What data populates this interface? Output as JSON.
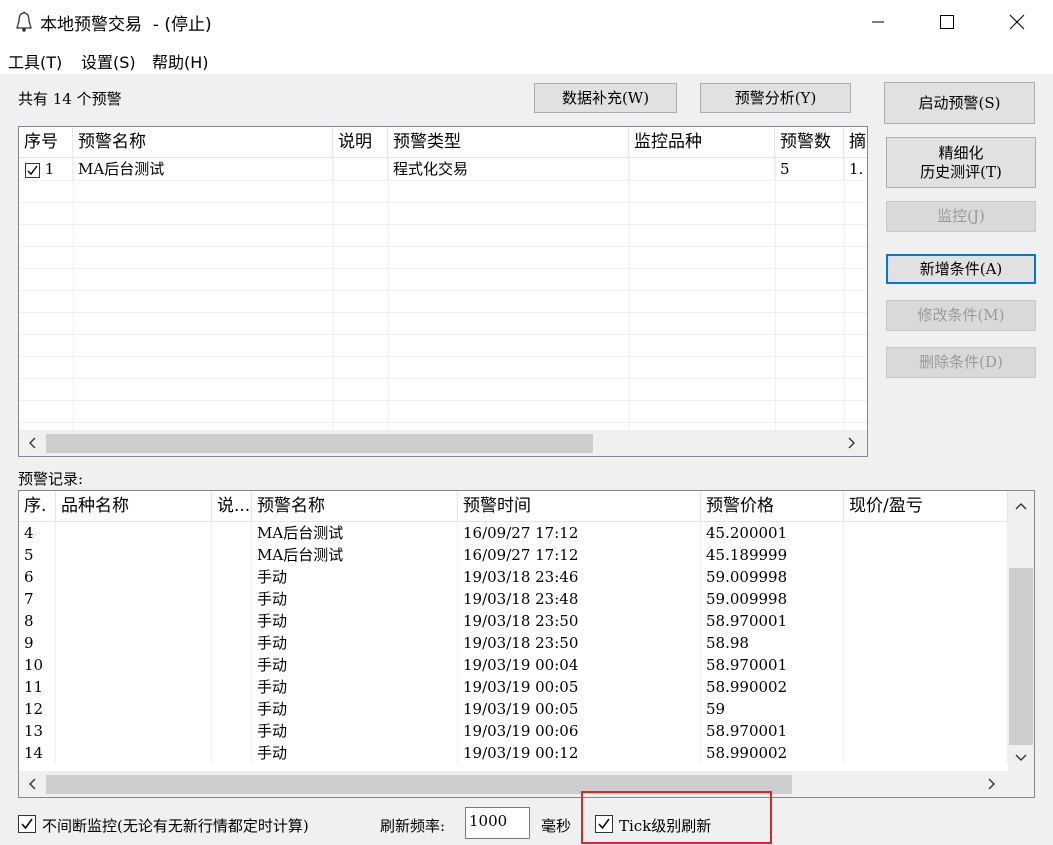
{
  "window": {
    "title": "本地预警交易  - (停止)",
    "minimize_icon": "minimize-icon",
    "maximize_icon": "maximize-icon",
    "close_icon": "close-icon"
  },
  "menu": [
    "工具(T)",
    "设置(S)",
    "帮助(H)"
  ],
  "alerts_summary": "共有 14 个预警",
  "buttons": {
    "data_supplement": "数据补充(W)",
    "alert_analysis": "预警分析(Y)",
    "start_alert": "启动预警(S)",
    "refine_line1": "精细化",
    "refine_line2": "历史测评(T)",
    "monitor": "监控(J)",
    "add_condition": "新增条件(A)",
    "edit_condition": "修改条件(M)",
    "delete_condition": "删除条件(D)"
  },
  "alerts_table": {
    "headers": [
      "序号",
      "预警名称",
      "说明",
      "预警类型",
      "监控品种",
      "预警数",
      "摘"
    ],
    "rows": [
      {
        "checked": true,
        "no": "1",
        "name": "MA后台测试",
        "desc": "",
        "type": "程式化交易",
        "symbol": "",
        "count": "5",
        "extra": "1."
      }
    ]
  },
  "records_label": "预警记录:",
  "records_table": {
    "headers": [
      "序.",
      "品种名称",
      "说...",
      "预警名称",
      "预警时间",
      "预警价格",
      "现价/盈亏"
    ],
    "rows": [
      {
        "no": "4",
        "symbol": "",
        "desc": "",
        "name": "MA后台测试",
        "time": "16/09/27 17:12",
        "price": "45.200001",
        "pnl": ""
      },
      {
        "no": "5",
        "symbol": "",
        "desc": "",
        "name": "MA后台测试",
        "time": "16/09/27 17:12",
        "price": "45.189999",
        "pnl": ""
      },
      {
        "no": "6",
        "symbol": "",
        "desc": "",
        "name": "手动",
        "time": "19/03/18 23:46",
        "price": "59.009998",
        "pnl": ""
      },
      {
        "no": "7",
        "symbol": "",
        "desc": "",
        "name": "手动",
        "time": "19/03/18 23:48",
        "price": "59.009998",
        "pnl": ""
      },
      {
        "no": "8",
        "symbol": "",
        "desc": "",
        "name": "手动",
        "time": "19/03/18 23:50",
        "price": "58.970001",
        "pnl": ""
      },
      {
        "no": "9",
        "symbol": "",
        "desc": "",
        "name": "手动",
        "time": "19/03/18 23:50",
        "price": "58.98",
        "pnl": ""
      },
      {
        "no": "10",
        "symbol": "",
        "desc": "",
        "name": "手动",
        "time": "19/03/19 00:04",
        "price": "58.970001",
        "pnl": ""
      },
      {
        "no": "11",
        "symbol": "",
        "desc": "",
        "name": "手动",
        "time": "19/03/19 00:05",
        "price": "58.990002",
        "pnl": ""
      },
      {
        "no": "12",
        "symbol": "",
        "desc": "",
        "name": "手动",
        "time": "19/03/19 00:05",
        "price": "59",
        "pnl": ""
      },
      {
        "no": "13",
        "symbol": "",
        "desc": "",
        "name": "手动",
        "time": "19/03/19 00:06",
        "price": "58.970001",
        "pnl": ""
      },
      {
        "no": "14",
        "symbol": "",
        "desc": "",
        "name": "手动",
        "time": "19/03/19 00:12",
        "price": "58.990002",
        "pnl": ""
      }
    ]
  },
  "bottom": {
    "continuous_checked": true,
    "continuous_label": "不间断监控(无论有无新行情都定时计算)",
    "refresh_label": "刷新频率:",
    "refresh_value": "1000",
    "unit": "毫秒",
    "tick_checked": true,
    "tick_label": "Tick级别刷新"
  },
  "highlight_color": "#e0242a",
  "accent_color": "#0078d7"
}
